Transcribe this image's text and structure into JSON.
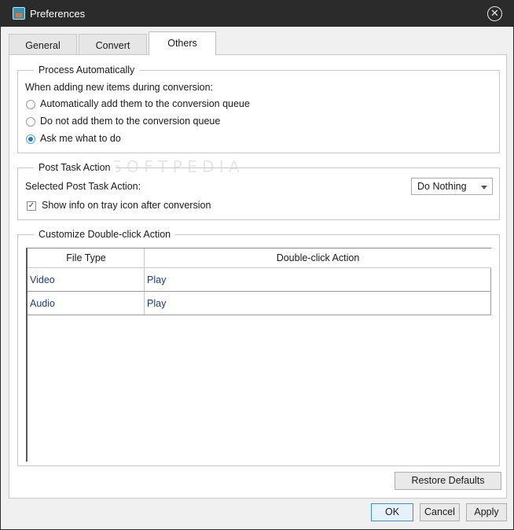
{
  "window": {
    "title": "Preferences",
    "close_glyph": "✕",
    "icons": {
      "app": "app-logo-icon",
      "close": "close-circle-icon"
    }
  },
  "tabs": [
    {
      "label": "General",
      "active": false
    },
    {
      "label": "Convert",
      "active": false
    },
    {
      "label": "Others",
      "active": true
    }
  ],
  "process": {
    "legend": "Process Automatically",
    "prompt": "When adding new items during conversion:",
    "options": [
      {
        "label": "Automatically add them to the conversion queue",
        "selected": false
      },
      {
        "label": "Do not add them to the conversion queue",
        "selected": false
      },
      {
        "label": "Ask me what to do",
        "selected": true
      }
    ]
  },
  "post_task": {
    "legend": "Post Task Action",
    "selected_label": "Selected Post Task Action:",
    "dropdown_value": "Do Nothing",
    "tray_label": "Show info on tray icon after conversion",
    "tray_checked": true,
    "check_glyph": "✓"
  },
  "double_click": {
    "legend": "Customize Double-click Action",
    "columns": [
      "File Type",
      "Double-click Action"
    ],
    "rows": [
      {
        "type": "Video",
        "action": "Play"
      },
      {
        "type": "Audio",
        "action": "Play"
      }
    ]
  },
  "buttons": {
    "restore": "Restore Defaults",
    "ok": "OK",
    "cancel": "Cancel",
    "apply": "Apply"
  },
  "colors": {
    "titlebar": "#2b2b2b",
    "accent": "#2a7dc0",
    "link_text": "#1a3f7a"
  }
}
